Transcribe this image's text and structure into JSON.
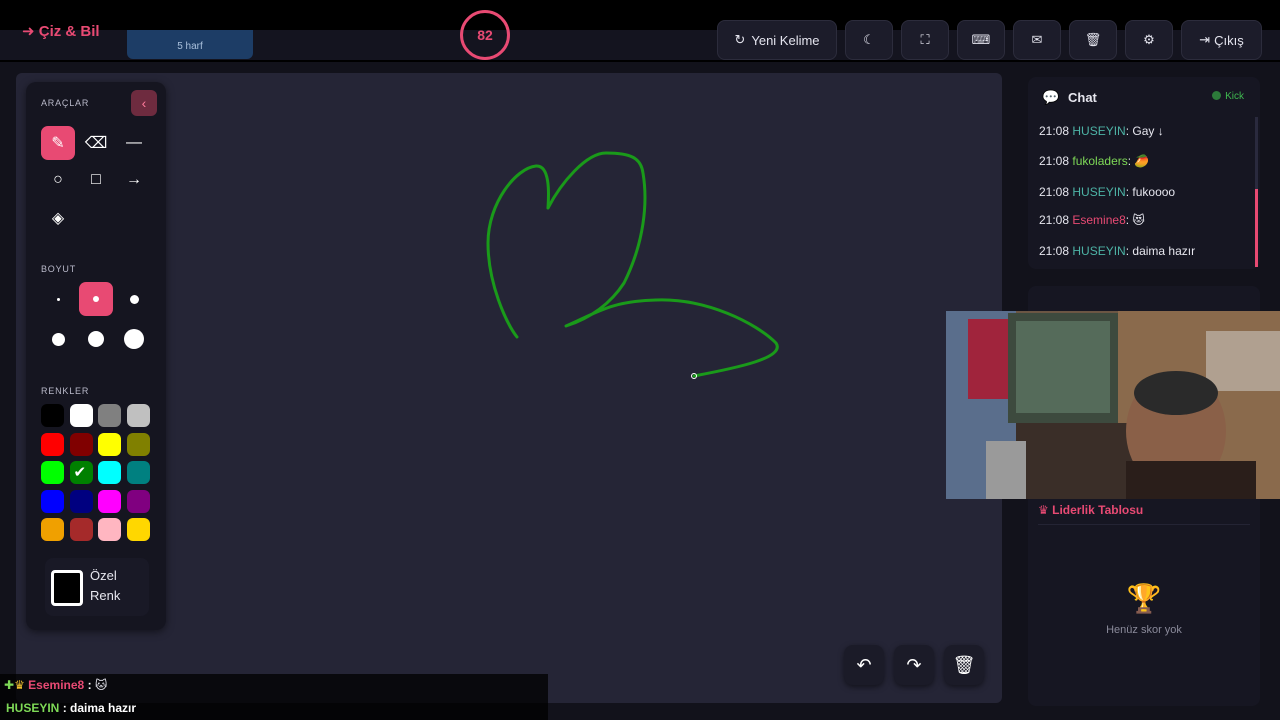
{
  "header": {
    "logo": "Çiz & Bil",
    "word_hint": "5 harf",
    "timer": "82",
    "new_word_label": "Yeni Kelime",
    "exit_label": "Çıkış"
  },
  "tools_panel": {
    "tools_heading": "ARAÇLAR",
    "size_heading": "BOYUT",
    "colors_heading": "RENKLER",
    "custom_color_label": "Özel Renk"
  },
  "colors": {
    "accent": "#e84a73",
    "stroke": "#1a9a1a",
    "swatches": [
      "#000000",
      "#ffffff",
      "#808080",
      "#c0c0c0",
      "#ff0000",
      "#800000",
      "#ffff00",
      "#808000",
      "#00ff00",
      "#008000",
      "#00ffff",
      "#008080",
      "#0000ff",
      "#000080",
      "#ff00ff",
      "#800080",
      "#f0a000",
      "#a52a2a",
      "#ffb6c1",
      "#ffd700"
    ],
    "selected_swatch": 9
  },
  "chat": {
    "title": "Chat",
    "status": "Kick",
    "messages": [
      {
        "time": "21:08",
        "user": "HUSEYIN",
        "text": "Gay ↓"
      },
      {
        "time": "21:08",
        "user": "fukoladers",
        "text": "🥭"
      },
      {
        "time": "21:08",
        "user": "HUSEYIN",
        "text": "fukoooo"
      },
      {
        "time": "21:08",
        "user": "Esemine8",
        "text": "😻"
      },
      {
        "time": "21:08",
        "user": "HUSEYIN",
        "text": "daima hazır"
      }
    ]
  },
  "leaderboard": {
    "title": "Liderlik Tablosu",
    "empty": "Henüz skor yok"
  },
  "overlay": {
    "line1_user": "Esemine8",
    "line1_text": "🐱",
    "line2_user": "HUSEYIN",
    "line2_text": "daima hazır"
  }
}
